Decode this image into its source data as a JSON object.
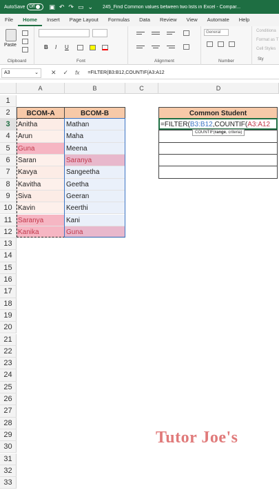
{
  "titlebar": {
    "autosave_label": "AutoSave",
    "autosave_state": "Off",
    "doc_title": "245_Find Common values between two lists in Excel - Compar..."
  },
  "tabs": [
    {
      "label": "File"
    },
    {
      "label": "Home"
    },
    {
      "label": "Insert"
    },
    {
      "label": "Page Layout"
    },
    {
      "label": "Formulas"
    },
    {
      "label": "Data"
    },
    {
      "label": "Review"
    },
    {
      "label": "View"
    },
    {
      "label": "Automate"
    },
    {
      "label": "Help"
    }
  ],
  "ribbon": {
    "paste_label": "Paste",
    "clipboard_label": "Clipboard",
    "font_label": "Font",
    "alignment_label": "Alignment",
    "number_label": "Number",
    "number_format": "General",
    "styles_label": "Sty",
    "cond_label": "Conditiona",
    "format_as_label": "Format as T",
    "cell_styles_label": "Cell Styles",
    "bold": "B",
    "italic": "I",
    "underline": "U"
  },
  "formula_bar": {
    "name_box": "A3",
    "formula": "=FILTER(B3:B12,COUNTIF(A3:A12"
  },
  "grid": {
    "columns": [
      "A",
      "B",
      "C",
      "D"
    ],
    "rows": [
      "1",
      "2",
      "3",
      "4",
      "5",
      "6",
      "7",
      "8",
      "9",
      "10",
      "11",
      "12",
      "13",
      "14",
      "15",
      "16",
      "17",
      "18",
      "19",
      "20",
      "21",
      "22",
      "23",
      "24",
      "25",
      "26",
      "27",
      "28",
      "29",
      "30",
      "31",
      "32",
      "33"
    ],
    "header_a": "BCOM-A",
    "header_b": "BCOM-B",
    "header_d": "Common Student",
    "list_a": [
      "Anitha",
      "Arun",
      "Guna",
      "Saran",
      "Kavya",
      "Kavitha",
      "Siva",
      "Kavin",
      "Saranya",
      "Kanika"
    ],
    "list_b": [
      "Mathan",
      "Maha",
      "Meena",
      "Saranya",
      "Sangeetha",
      "Geetha",
      "Geeran",
      "Keerthi",
      "Kani",
      "Guna"
    ],
    "editing_formula": {
      "part1": "=FILTER(",
      "part2": "B3:B12",
      "part3": ",COUNTIF(",
      "part4": "A3:A12"
    },
    "tooltip": {
      "fn": "COUNTIF(",
      "arg1": "range",
      "rest": ", criteria)"
    }
  },
  "watermark": "Tutor Joe's",
  "colors": {
    "accent": "#1e6e42",
    "header_fill": "#f7c9a8",
    "match_fill_a": "#f6b6c3",
    "match_fill_b": "#e8b8cc",
    "match_text": "#c0394b"
  }
}
